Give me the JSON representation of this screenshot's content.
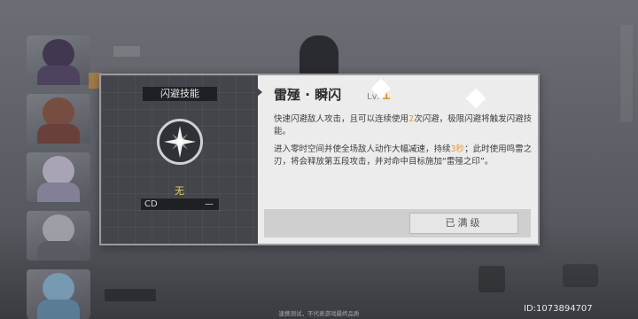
{
  "dialog": {
    "category_label": "闪避技能",
    "skill_icon": "lightning-star-icon",
    "state": "无",
    "cd_label": "CD",
    "cd_value": "—",
    "skill_name": "雷殛 · 瞬闪",
    "level_label": "Lv.",
    "level_value": "1",
    "description": {
      "p1_a": "快速闪避敌人攻击，且可以连续使用",
      "p1_num": "2",
      "p1_b": "次闪避，极限闪避将触发闪避技能。",
      "p2_a": "进入零时空间并使全场敌人动作大幅减速，持续",
      "p2_num": "3秒",
      "p2_b": "；此时使用鸣雷之刃，将会释放第五段攻击，并对命中目标施加“雷殛之印”。"
    },
    "maxed_button": "已满级"
  },
  "footer": {
    "note": "速携测试，不代表游戏最终品质",
    "uid": "ID:1073894707"
  },
  "colors": {
    "accent": "#e8962a",
    "state": "#e3d262",
    "panel_dark": "#43454a",
    "panel_light": "#ececec"
  }
}
